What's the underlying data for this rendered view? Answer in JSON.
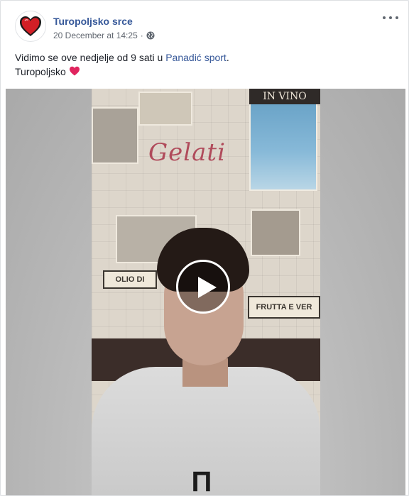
{
  "post": {
    "page_name": "Turopoljsko srce",
    "timestamp": "20 December at 14:25",
    "separator": "·",
    "privacy_icon": "globe-icon",
    "more_icon": "more-options-icon",
    "text": {
      "line1_prefix": "Vidimo se ove nedjelje od 9 sati u ",
      "line1_link": "Panadić sport",
      "line1_suffix": ".",
      "line2": "Turopoljsko",
      "line2_emoji": "red-heart-icon"
    }
  },
  "video": {
    "wall_words": {
      "gelati": "Gelati",
      "in_vino": "IN VINO",
      "olio": "OLIO DI",
      "frutta": "FRUTTA E VER"
    },
    "play_icon": "play-icon"
  },
  "colors": {
    "link": "#365899",
    "meta": "#616770",
    "text": "#1d2129",
    "heart": "#e0245e"
  }
}
